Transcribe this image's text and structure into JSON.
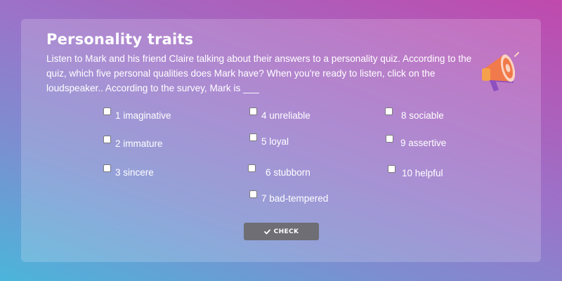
{
  "activity": {
    "title": "Personality traits",
    "instructions": "Listen to Mark and his friend Claire talking about their answers to a personality quiz. According to the quiz, which five personal qualities does Mark have? When you're ready to listen, click on the loudspeaker.. According to the survey, Mark is ___"
  },
  "speaker_icon": "loudspeaker-icon",
  "options": [
    {
      "label": "1 imaginative"
    },
    {
      "label": "2 immature"
    },
    {
      "label": "3 sincere"
    },
    {
      "label": "4 unreliable"
    },
    {
      "label": "5 loyal"
    },
    {
      "label": "6 stubborn"
    },
    {
      "label": "7 bad-tempered"
    },
    {
      "label": "8 sociable"
    },
    {
      "label": "9 assertive"
    },
    {
      "label": "10 helpful"
    }
  ],
  "check_button": {
    "label": "CHECK",
    "icon": "checkmark-icon"
  },
  "colors": {
    "panel_button": "#6e6e74",
    "speaker_orange": "#f07a4b",
    "speaker_purple": "#8e4fc0"
  }
}
